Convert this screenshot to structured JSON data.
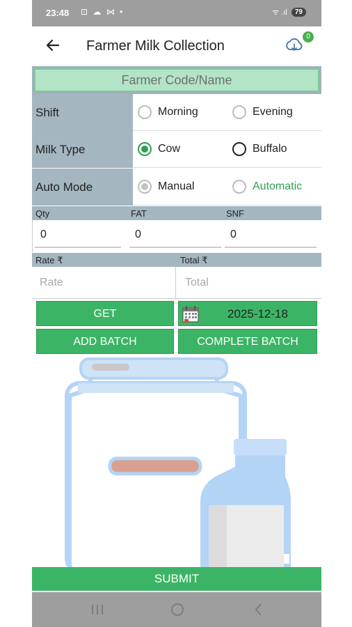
{
  "status_bar": {
    "time": "23:48",
    "icons": "⊡ ☁ ⋈ •",
    "signal": "ᯤ .ıl",
    "battery": "79"
  },
  "app_bar": {
    "title": "Farmer Milk Collection",
    "sync_count": "0"
  },
  "farmer": {
    "placeholder": "Farmer Code/Name",
    "value": ""
  },
  "shift": {
    "label": "Shift",
    "options": [
      "Morning",
      "Evening"
    ],
    "selected": ""
  },
  "milk_type": {
    "label": "Milk Type",
    "options": [
      "Cow",
      "Buffalo"
    ],
    "selected": "Cow"
  },
  "auto_mode": {
    "label": "Auto Mode",
    "options": [
      "Manual",
      "Automatic"
    ],
    "selected": "Manual"
  },
  "measures": {
    "qty_label": "Qty",
    "qty_value": "0",
    "fat_label": "FAT",
    "fat_value": "0",
    "snf_label": "SNF",
    "snf_value": "0"
  },
  "rate": {
    "rate_label": "Rate ₹",
    "rate_placeholder": "Rate",
    "total_label": "Total ₹",
    "total_placeholder": "Total"
  },
  "buttons": {
    "get": "GET",
    "date": "2025-12-18",
    "add_batch": "ADD BATCH",
    "complete_batch": "COMPLETE BATCH",
    "submit": "SUBMIT"
  },
  "colors": {
    "accent": "#3bb565",
    "label_bg": "#a4b6c0",
    "farmer_field_bg": "#b3e4c6"
  }
}
